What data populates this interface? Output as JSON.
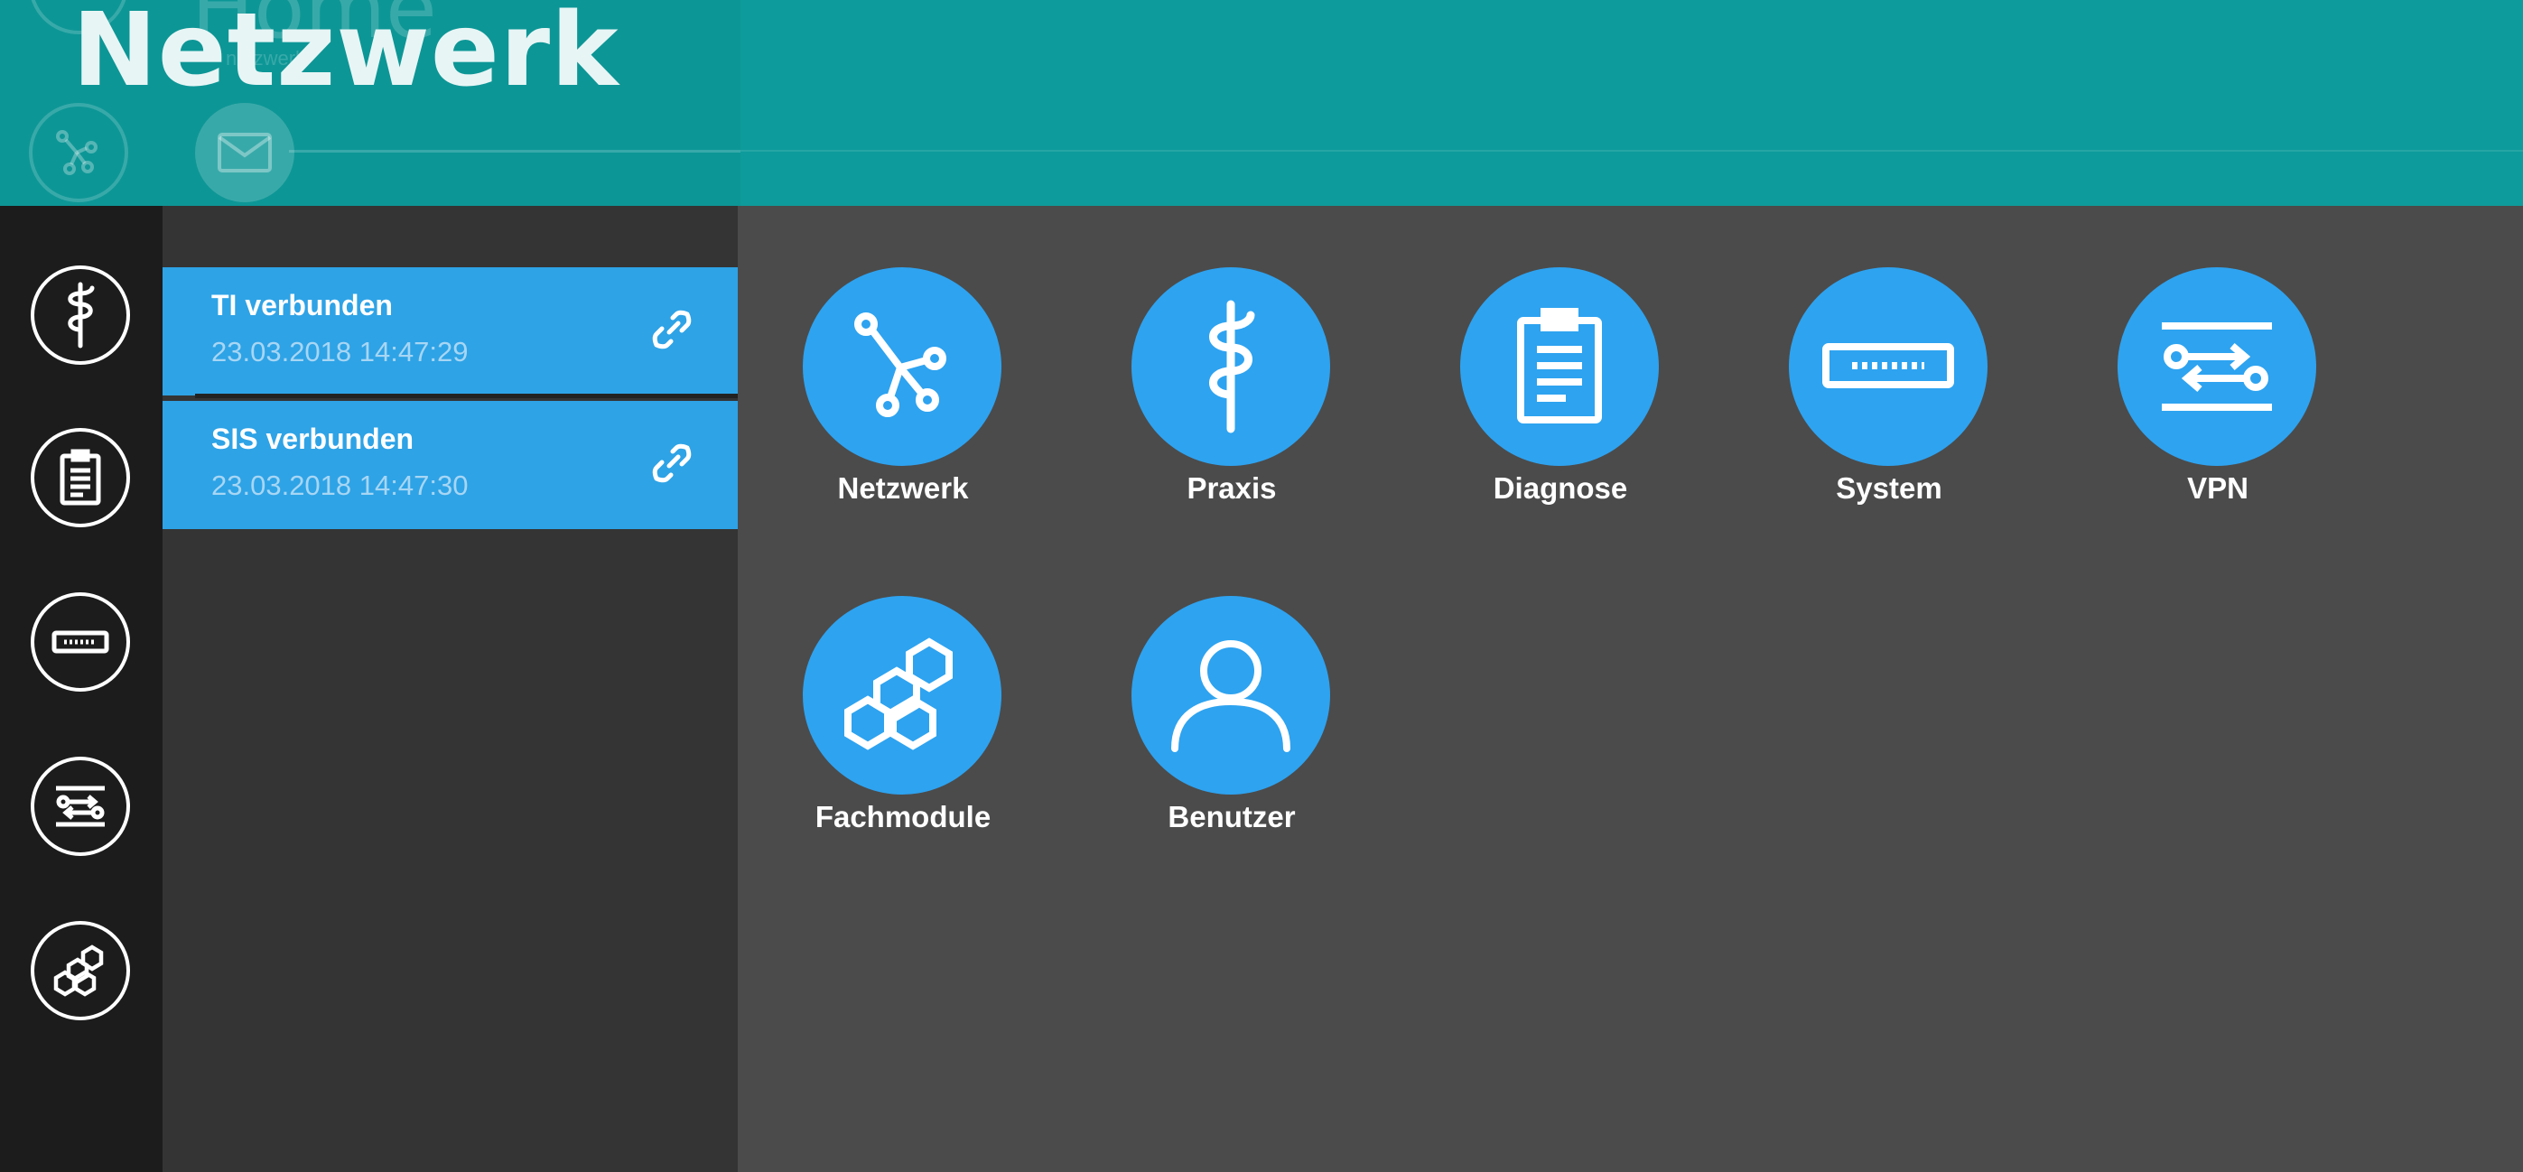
{
  "header": {
    "title": "Netzwerk",
    "ghost_title": "Home",
    "ghost_subtitle": "netzwerk"
  },
  "rail": {
    "items": [
      {
        "icon": "caduceus-icon",
        "label": "Praxis"
      },
      {
        "icon": "clipboard-icon",
        "label": "Diagnose"
      },
      {
        "icon": "router-icon",
        "label": "System"
      },
      {
        "icon": "vpn-icon",
        "label": "VPN"
      },
      {
        "icon": "hexagons-icon",
        "label": "Fachmodule"
      }
    ]
  },
  "status": {
    "items": [
      {
        "title": "TI verbunden",
        "time": "23.03.2018 14:47:29",
        "icon": "link-icon"
      },
      {
        "title": "SIS verbunden",
        "time": "23.03.2018 14:47:30",
        "icon": "link-icon"
      }
    ]
  },
  "tiles": [
    {
      "label": "Netzwerk",
      "icon": "network-icon"
    },
    {
      "label": "Praxis",
      "icon": "caduceus-icon"
    },
    {
      "label": "Diagnose",
      "icon": "clipboard-icon"
    },
    {
      "label": "System",
      "icon": "router-icon"
    },
    {
      "label": "VPN",
      "icon": "vpn-icon"
    },
    {
      "label": "Fachmodule",
      "icon": "hexagons-icon"
    },
    {
      "label": "Benutzer",
      "icon": "user-icon"
    }
  ],
  "colors": {
    "header": "#0e9b9b",
    "accent": "#2ea3f0",
    "rail": "#1c1c1c",
    "panel": "#343434",
    "main": "#4b4b4b"
  }
}
